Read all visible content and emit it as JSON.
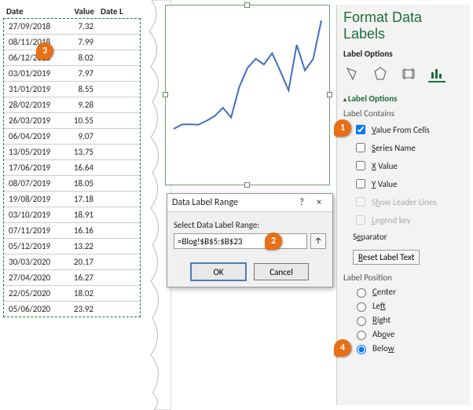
{
  "table": {
    "headers": [
      "Date",
      "Value",
      "Date L"
    ],
    "rows": [
      {
        "date": "27/09/2018",
        "value": "7.32"
      },
      {
        "date": "08/11/2018",
        "value": "7.99"
      },
      {
        "date": "06/12/2018",
        "value": "8.02"
      },
      {
        "date": "03/01/2019",
        "value": "7.97"
      },
      {
        "date": "31/01/2019",
        "value": "8.55"
      },
      {
        "date": "28/02/2019",
        "value": "9.28"
      },
      {
        "date": "26/03/2019",
        "value": "10.55"
      },
      {
        "date": "06/04/2019",
        "value": "9.07"
      },
      {
        "date": "13/05/2019",
        "value": "13.75"
      },
      {
        "date": "17/06/2019",
        "value": "16.64"
      },
      {
        "date": "08/07/2019",
        "value": "18.05"
      },
      {
        "date": "19/08/2019",
        "value": "17.18"
      },
      {
        "date": "03/10/2019",
        "value": "18.91"
      },
      {
        "date": "07/11/2019",
        "value": "16.16"
      },
      {
        "date": "05/12/2019",
        "value": "13.22"
      },
      {
        "date": "30/03/2020",
        "value": "20.17"
      },
      {
        "date": "27/04/2020",
        "value": "16.27"
      },
      {
        "date": "22/05/2020",
        "value": "18.02"
      },
      {
        "date": "05/06/2020",
        "value": "23.92"
      }
    ]
  },
  "dialog": {
    "title": "Data Label Range",
    "label": "Select Data Label Range:",
    "value": "=Blog!$B$5:$B$23",
    "help": "?",
    "close": "×",
    "ok": "OK",
    "cancel": "Cancel"
  },
  "panel": {
    "title": "Format Data Labels",
    "sub": "Label Options",
    "section": "Label Options",
    "contains": "Label Contains",
    "valueFromCells": "Value From Cells",
    "seriesName": "Series Name",
    "xValue": "X Value",
    "yValue": "Y Value",
    "showLeader": "Show Leader Lines",
    "legendKey": "Legend key",
    "separator": "Separator",
    "reset": "Reset Label Text",
    "position": "Label Position",
    "center": "Center",
    "left": "Left",
    "right": "Right",
    "above": "Above",
    "below": "Below"
  },
  "callouts": {
    "c1": "1",
    "c2": "2",
    "c3": "3",
    "c4": "4"
  },
  "chart_data": {
    "type": "line",
    "x": [
      "27/09/2018",
      "08/11/2018",
      "06/12/2018",
      "03/01/2019",
      "31/01/2019",
      "28/02/2019",
      "26/03/2019",
      "06/04/2019",
      "13/05/2019",
      "17/06/2019",
      "08/07/2019",
      "19/08/2019",
      "03/10/2019",
      "07/11/2019",
      "05/12/2019",
      "30/03/2020",
      "27/04/2020",
      "22/05/2020",
      "05/06/2020"
    ],
    "series": [
      {
        "name": "Value",
        "values": [
          7.32,
          7.99,
          8.02,
          7.97,
          8.55,
          9.28,
          10.55,
          9.07,
          13.75,
          16.64,
          18.05,
          17.18,
          18.91,
          16.16,
          13.22,
          20.17,
          16.27,
          18.02,
          23.92
        ]
      }
    ],
    "title": "",
    "xlabel": "",
    "ylabel": "",
    "ylim": [
      0,
      25
    ]
  }
}
